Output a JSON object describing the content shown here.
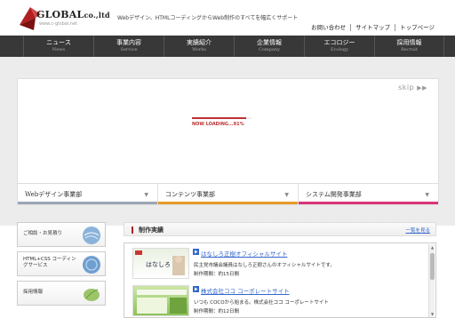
{
  "header": {
    "logo_name": "GLOBAL",
    "logo_suffix": "co.,ltd",
    "logo_url": "www.c-global.net",
    "tagline": "Webデザイン、HTMLコーディングからWeb制作のすべてを幅広くサポート",
    "util_links": [
      "お問い合わせ",
      "サイトマップ",
      "トップページ"
    ]
  },
  "nav": [
    {
      "jp": "ニュース",
      "en": "News"
    },
    {
      "jp": "事業内容",
      "en": "Service"
    },
    {
      "jp": "実績紹介",
      "en": "Works"
    },
    {
      "jp": "企業情報",
      "en": "Company"
    },
    {
      "jp": "エコロジー",
      "en": "Ecology"
    },
    {
      "jp": "採用情報",
      "en": "Recruit"
    }
  ],
  "hero": {
    "skip_label": "skip",
    "loading_text": "NOW LOADING...91%",
    "loading_fraction": 0.91
  },
  "tabs": [
    {
      "label": "Webデザイン事業部",
      "color": "#9aa7b5"
    },
    {
      "label": "コンテンツ事業部",
      "color": "#e89a2a"
    },
    {
      "label": "システム開発事業部",
      "color": "#d8357a"
    }
  ],
  "sidebar": [
    {
      "label": "ご相談・お見積り"
    },
    {
      "label": "HTML+CSS コーディングサービス"
    },
    {
      "label": "採用情報"
    }
  ],
  "main": {
    "title": "制作実績",
    "more_link": "一覧を見る",
    "works": [
      {
        "title": "はなしろ正樹オフィシャルサイト",
        "desc": "民主党市議会議員はなしろ正樹さんのオフィシャルサイトです。",
        "date": "制作期間：約15日間",
        "thumb_text": "はなしろ"
      },
      {
        "title": "株式会社ココ コーポレートサイト",
        "desc": "いつも COCOから始まる。株式会社ココ コーポレートサイト",
        "date": "制作期間：約12日間",
        "thumb_text": ""
      }
    ]
  },
  "colors": {
    "nav_bg": "#383838",
    "accent_red": "#aa2222",
    "link_blue": "#3366cc"
  }
}
